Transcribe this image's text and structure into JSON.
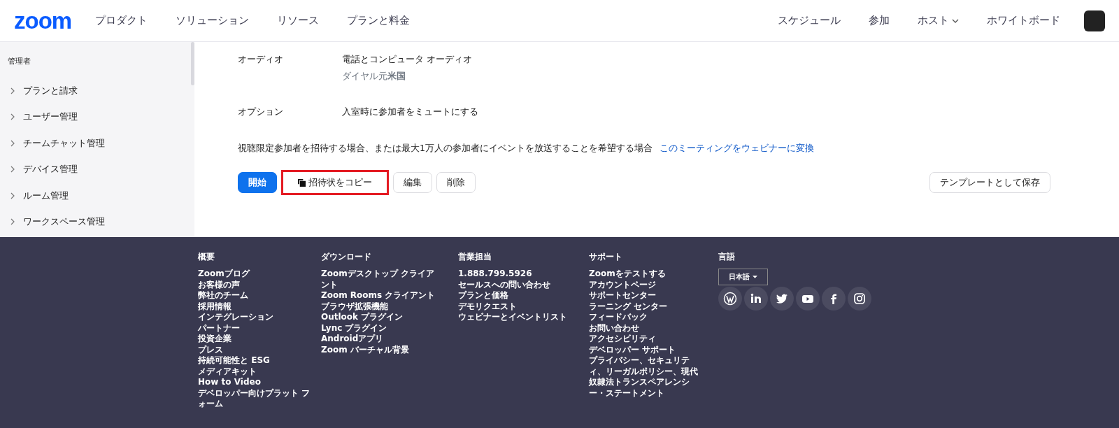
{
  "header": {
    "logo": "zoom",
    "nav_left": [
      "プロダクト",
      "ソリューション",
      "リソース",
      "プランと料金"
    ],
    "nav_right": [
      {
        "label": "スケジュール",
        "dropdown": false
      },
      {
        "label": "参加",
        "dropdown": false
      },
      {
        "label": "ホスト",
        "dropdown": true
      },
      {
        "label": "ホワイトボード",
        "dropdown": false
      }
    ]
  },
  "sidebar": {
    "heading": "管理者",
    "items": [
      {
        "label": "プランと請求",
        "expanded": false
      },
      {
        "label": "ユーザー管理",
        "expanded": false
      },
      {
        "label": "チームチャット管理",
        "expanded": false
      },
      {
        "label": "デバイス管理",
        "expanded": false
      },
      {
        "label": "ルーム管理",
        "expanded": false
      },
      {
        "label": "ワークスペース管理",
        "expanded": false
      }
    ]
  },
  "details": [
    {
      "label": "オーディオ",
      "values": [
        "電話とコンピュータ オーディオ",
        "ダイヤル元**米国**"
      ]
    },
    {
      "label": "オプション",
      "values": [
        "入室時に参加者をミュートにする"
      ]
    }
  ],
  "webinar_note": {
    "text": "視聴限定参加者を招待する場合、または最大1万人の参加者にイベントを放送することを希望する場合",
    "link": "このミーティングをウェビナーに変換"
  },
  "buttons": [
    {
      "label": "開始",
      "kind": "primary",
      "highlighted": false
    },
    {
      "label": "招待状をコピー",
      "kind": "copy",
      "highlighted": true
    },
    {
      "label": "編集",
      "kind": "default",
      "highlighted": false
    },
    {
      "label": "削除",
      "kind": "default",
      "highlighted": false
    }
  ],
  "save_template_button": "テンプレートとして保存",
  "footer": {
    "columns": [
      {
        "heading": "概要",
        "links": [
          "Zoomブログ",
          "お客様の声",
          "弊社のチーム",
          "採用情報",
          "インテグレーション",
          "パートナー",
          "投資企業",
          "プレス",
          "持続可能性と ESG",
          "メディアキット",
          "How to Video",
          "デベロッパー向けプラット フォーム"
        ]
      },
      {
        "heading": "ダウンロード",
        "links": [
          "Zoomデスクトップ クライアント",
          "Zoom Rooms クライアント",
          "ブラウザ拡張機能",
          "Outlook プラグイン",
          "Lync プラグイン",
          "Androidアプリ",
          "Zoom バーチャル背景"
        ]
      },
      {
        "heading": "営業担当",
        "links": [
          "1.888.799.5926",
          "セールスへの問い合わせ",
          "プランと価格",
          "デモリクエスト",
          "ウェビナーとイベントリスト"
        ]
      },
      {
        "heading": "サポート",
        "links": [
          "Zoomをテストする",
          "アカウントページ",
          "サポートセンター",
          "ラーニング センター",
          "フィードバック",
          "お問い合わせ",
          "アクセシビリティ",
          "デベロッパー サポート",
          "プライバシー、セキュリティ、リーガルポリシー、現代奴隷法トランスペアレンシー・ステートメント"
        ]
      }
    ],
    "language": {
      "heading": "言語",
      "value": "日本語"
    }
  }
}
